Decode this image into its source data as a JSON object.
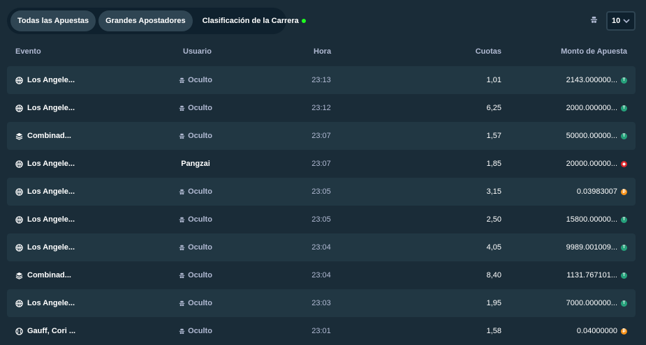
{
  "tabs": [
    {
      "label": "Todas las Apuestas"
    },
    {
      "label": "Grandes Apostadores"
    },
    {
      "label": "Clasificación de la Carrera"
    }
  ],
  "page_size": {
    "value": "10"
  },
  "columns": {
    "event": "Evento",
    "user": "Usuario",
    "time": "Hora",
    "odds": "Cuotas",
    "amount": "Monto de Apuesta"
  },
  "rows": [
    {
      "event": "Los Angele...",
      "event_icon": "basketball-icon",
      "user": "Oculto",
      "hidden": true,
      "time": "23:13",
      "odds": "1,01",
      "amount": "2143.000000...",
      "coin": "tether",
      "coin_color": "#26a17b"
    },
    {
      "event": "Los Angele...",
      "event_icon": "basketball-icon",
      "user": "Oculto",
      "hidden": true,
      "time": "23:12",
      "odds": "6,25",
      "amount": "2000.000000...",
      "coin": "tether",
      "coin_color": "#26a17b"
    },
    {
      "event": "Combinad...",
      "event_icon": "layers-icon",
      "user": "Oculto",
      "hidden": true,
      "time": "23:07",
      "odds": "1,57",
      "amount": "50000.00000...",
      "coin": "tether",
      "coin_color": "#26a17b"
    },
    {
      "event": "Los Angele...",
      "event_icon": "basketball-icon",
      "user": "Pangzai",
      "hidden": false,
      "time": "23:07",
      "odds": "1,85",
      "amount": "20000.00000...",
      "coin": "tron",
      "coin_color": "#e0262b"
    },
    {
      "event": "Los Angele...",
      "event_icon": "basketball-icon",
      "user": "Oculto",
      "hidden": true,
      "time": "23:05",
      "odds": "3,15",
      "amount": "0.03983007",
      "coin": "bitcoin",
      "coin_color": "#f7931a"
    },
    {
      "event": "Los Angele...",
      "event_icon": "basketball-icon",
      "user": "Oculto",
      "hidden": true,
      "time": "23:05",
      "odds": "2,50",
      "amount": "15800.00000...",
      "coin": "tether",
      "coin_color": "#26a17b"
    },
    {
      "event": "Los Angele...",
      "event_icon": "basketball-icon",
      "user": "Oculto",
      "hidden": true,
      "time": "23:04",
      "odds": "4,05",
      "amount": "9989.001009...",
      "coin": "tether",
      "coin_color": "#26a17b"
    },
    {
      "event": "Combinad...",
      "event_icon": "layers-icon",
      "user": "Oculto",
      "hidden": true,
      "time": "23:04",
      "odds": "8,40",
      "amount": "1131.767101...",
      "coin": "tether",
      "coin_color": "#26a17b"
    },
    {
      "event": "Los Angele...",
      "event_icon": "basketball-icon",
      "user": "Oculto",
      "hidden": true,
      "time": "23:03",
      "odds": "1,95",
      "amount": "7000.000000...",
      "coin": "tether",
      "coin_color": "#26a17b"
    },
    {
      "event": "Gauff, Cori ...",
      "event_icon": "tennis-icon",
      "user": "Oculto",
      "hidden": true,
      "time": "23:01",
      "odds": "1,58",
      "amount": "0.04000000",
      "coin": "bitcoin",
      "coin_color": "#f7931a"
    }
  ]
}
